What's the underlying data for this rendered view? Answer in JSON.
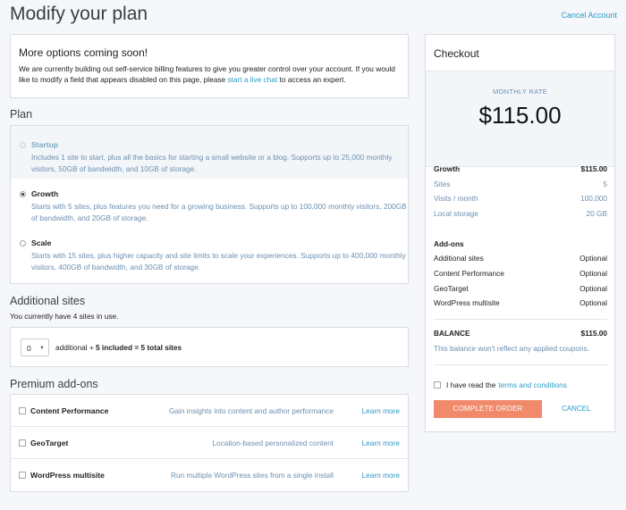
{
  "header": {
    "title": "Modify your plan",
    "cancel_account": "Cancel Account"
  },
  "notice": {
    "title": "More options coming soon!",
    "text_before": "We are currently building out self-service billing features to give you greater control over your account. If you would like to modify a field that appears disabled on this page, please ",
    "link": "start a live chat",
    "text_after": " to access an expert."
  },
  "plan": {
    "section_title": "Plan",
    "options": [
      {
        "name": "Startup",
        "description": "Includes 1 site to start, plus all the basics for starting a small website or a blog. Supports up to 25,000 monthly visitors, 50GB of bandwidth, and 10GB of storage.",
        "selected": false,
        "disabled": true
      },
      {
        "name": "Growth",
        "description": "Starts with 5 sites, plus features you need for a growing business. Supports up to 100,000 monthly visitors, 200GB of bandwidth, and 20GB of storage.",
        "selected": true,
        "disabled": false
      },
      {
        "name": "Scale",
        "description": "Starts with 15 sites, plus higher capacity and site limits to scale your experiences. Supports up to 400,000 monthly visitors, 400GB of bandwidth, and 30GB of storage.",
        "selected": false,
        "disabled": false
      }
    ]
  },
  "sites": {
    "section_title": "Additional sites",
    "current_text": "You currently have 4 sites in use.",
    "select_value": "0",
    "summary_prefix": "additional + ",
    "summary_bold": "5 included = 5 total sites"
  },
  "addons": {
    "section_title": "Premium add-ons",
    "items": [
      {
        "name": "Content Performance",
        "description": "Gain insights into content and author performance",
        "link": "Learn more"
      },
      {
        "name": "GeoTarget",
        "description": "Location-based personalized content",
        "link": "Learn more"
      },
      {
        "name": "WordPress multisite",
        "description": "Run multiple WordPress sites from a single install",
        "link": "Learn more"
      }
    ]
  },
  "checkout": {
    "title": "Checkout",
    "rate_label": "MONTHLY RATE",
    "rate_value": "$115.00",
    "plan_name": "Growth",
    "plan_price": "$115.00",
    "details": [
      {
        "label": "Sites",
        "value": "5"
      },
      {
        "label": "Visits / month",
        "value": "100,000"
      },
      {
        "label": "Local storage",
        "value": "20 GB"
      }
    ],
    "addons_title": "Add-ons",
    "addons": [
      {
        "label": "Additional sites",
        "value": "Optional"
      },
      {
        "label": "Content Performance",
        "value": "Optional"
      },
      {
        "label": "GeoTarget",
        "value": "Optional"
      },
      {
        "label": "WordPress multisite",
        "value": "Optional"
      }
    ],
    "balance_label": "BALANCE",
    "balance_value": "$115.00",
    "balance_note": "This balance won't reflect any applied coupons.",
    "terms_prefix": "I have read the ",
    "terms_link": "terms and conditions",
    "complete_label": "COMPLETE ORDER",
    "cancel_label": "CANCEL"
  },
  "colors": {
    "accent": "#2e9bc6",
    "button": "#f08a6a",
    "muted_text": "#6b8fb0"
  }
}
